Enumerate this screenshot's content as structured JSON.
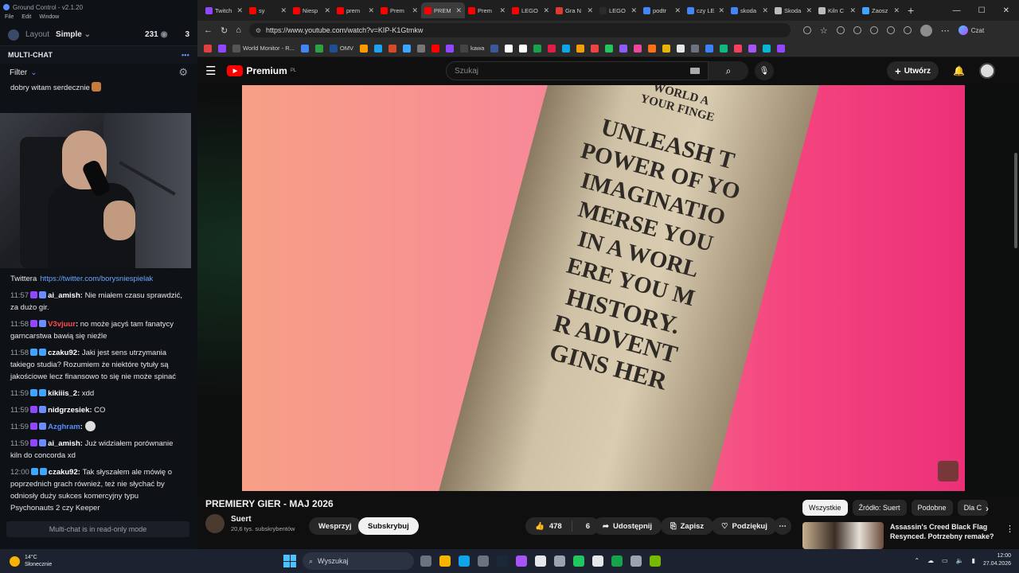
{
  "app": {
    "title": "Ground Control - v2.1.20",
    "menu": [
      "File",
      "Edit",
      "Window"
    ],
    "layout_label": "Layout",
    "layout_value": "Simple",
    "viewers": "231",
    "viewers2": "3"
  },
  "multichat": {
    "title": "MULTI-CHAT",
    "filter": "Filter",
    "read_only": "Multi-chat is in read-only mode",
    "first_msg": "dobry witam serdecznie",
    "twitter_prefix": "Twittera",
    "twitter_link": "https://twitter.com/borysniespielak",
    "messages": [
      {
        "time": "11:57",
        "user": "ai_amish",
        "text": "Nie miałem czasu sprawdzić, za dużo gir.",
        "color": "#ffffff",
        "badge": "bt"
      },
      {
        "time": "11:58",
        "user": "V3vjuur",
        "text": "no może jacyś tam fanatycy garncarstwa bawią się nieźle",
        "color": "#ff4b4b",
        "badge": "bt"
      },
      {
        "time": "11:58",
        "user": "czaku92",
        "text": "Jaki jest sens utrzymania takiego studia? Rozumiem że niektóre tytuły są jakościowe lecz finansowo to się nie może spinać",
        "color": "#ffffff",
        "badge": "bs"
      },
      {
        "time": "11:59",
        "user": "kikiiis_2",
        "text": "xdd",
        "color": "#ffffff",
        "badge": "bs"
      },
      {
        "time": "11:59",
        "user": "nidgrzesiek",
        "text": "CO",
        "color": "#ffffff",
        "badge": "bt"
      },
      {
        "time": "11:59",
        "user": "Azghram",
        "text": "",
        "color": "#5b8cff",
        "badge": "bt"
      },
      {
        "time": "11:59",
        "user": "ai_amish",
        "text": "Już widziałem porównanie kiln do concorda xd",
        "color": "#ffffff",
        "badge": "bt"
      },
      {
        "time": "12:00",
        "user": "czaku92",
        "text": "Tak słyszałem ale mówię o poprzednich grach również, też nie słychać by odniosły duży sukces komercyjny typu Psychonauts 2 czy Keeper",
        "color": "#ffffff",
        "badge": "bs"
      }
    ]
  },
  "browser": {
    "tabs": [
      {
        "label": "Twitch",
        "color": "#9146ff",
        "active": false
      },
      {
        "label": "sy",
        "color": "#ff0000",
        "active": false
      },
      {
        "label": "Niesp",
        "color": "#ff0000",
        "active": false
      },
      {
        "label": "prem",
        "color": "#ff0000",
        "active": false
      },
      {
        "label": "Prem",
        "color": "#ff0000",
        "active": false
      },
      {
        "label": "PREM",
        "color": "#ff0000",
        "active": true
      },
      {
        "label": "Prem",
        "color": "#ff0000",
        "active": false
      },
      {
        "label": "LEGO",
        "color": "#ff0000",
        "active": false
      },
      {
        "label": "Gra N",
        "color": "#e03a2f",
        "active": false
      },
      {
        "label": "LEGO",
        "color": "#2b2b2b",
        "active": false
      },
      {
        "label": "podtr",
        "color": "#4285f4",
        "active": false
      },
      {
        "label": "czy LE",
        "color": "#4285f4",
        "active": false
      },
      {
        "label": "skoda",
        "color": "#4285f4",
        "active": false
      },
      {
        "label": "Skoda",
        "color": "#bbbbbb",
        "active": false
      },
      {
        "label": "Kiln C",
        "color": "#bbbbbb",
        "active": false
      },
      {
        "label": "Zaosz",
        "color": "#3ea6ff",
        "active": false
      }
    ],
    "url": "https://www.youtube.com/watch?v=KIP-K1Gtmkw",
    "czat": "Czat",
    "bookmarks": [
      {
        "label": "World Monitor - R...",
        "color": "#555555"
      },
      {
        "label": "OMV",
        "color": "#1d4f91"
      },
      {
        "label": "kawa",
        "color": "#444444"
      }
    ],
    "bookmark_icons": [
      "#e04040",
      "#9146ff",
      "#4285f4",
      "#2ea043",
      "#ff9900",
      "#1da1f2",
      "#d64a2a",
      "#3ea6ff",
      "#777777",
      "#ff0000",
      "#9146ff",
      "#3b5998",
      "#ffffff",
      "#ffffff",
      "#16a34a",
      "#e11d48",
      "#0ea5e9",
      "#f59e0b",
      "#ef4444",
      "#22c55e",
      "#8b5cf6",
      "#ec4899",
      "#f97316",
      "#eab308",
      "#e5e7eb",
      "#6b7280",
      "#3b82f6",
      "#10b981",
      "#f43f5e",
      "#a855f7",
      "#06b6d4",
      "#9146ff"
    ]
  },
  "youtube": {
    "logo": "Premium",
    "region": "PL",
    "search_placeholder": "Szukaj",
    "create": "Utwórz",
    "video_text": [
      "WORLD A",
      "YOUR FINGE",
      "UNLEASH T",
      "POWER OF YO",
      "IMAGINATIO",
      "MERSE YOU",
      "IN A WORL",
      "ERE YOU M",
      "HISTORY.",
      "R ADVENT",
      "GINS HER"
    ],
    "title": "PREMIERY GIER - MAJ 2026",
    "channel": "Suert",
    "subscribers": "20,6 tys. subskrybentów",
    "support": "Wesprzyj",
    "subscribe": "Subskrybuj",
    "likes": "478",
    "dislikes": "6",
    "share": "Udostępnij",
    "save": "Zapisz",
    "thanks": "Podziękuj",
    "chips": [
      "Wszystkie",
      "Źródło: Suert",
      "Podobne",
      "Dla C"
    ],
    "rec_title": "Assassin's Creed Black Flag Resynced. Potrzebny remake?"
  },
  "taskbar": {
    "temp": "14°C",
    "weather": "Słonecznie",
    "search": "Wyszukaj",
    "time": "12:00",
    "date": "27.04.2026",
    "icons": [
      "#6b7280",
      "#f4b400",
      "#0ea5e9",
      "#6b7280",
      "#1b2838",
      "#a855f7",
      "#e5e7eb",
      "#9ca3af",
      "#22c55e",
      "#e5e7eb",
      "#16a34a",
      "#9ca3af",
      "#76b900"
    ]
  }
}
